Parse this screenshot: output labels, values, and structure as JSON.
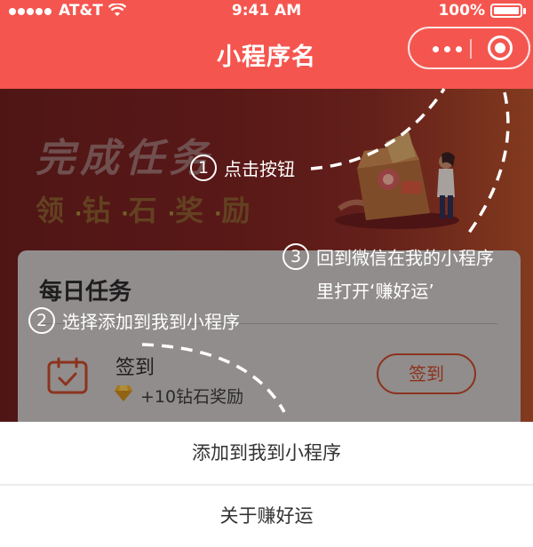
{
  "status_bar": {
    "carrier": "AT&T",
    "time": "9:41 AM",
    "battery": "100%"
  },
  "nav_bar": {
    "title": "小程序名",
    "menu_icon": "more-dots-icon",
    "close_icon": "target-circle-icon"
  },
  "banner": {
    "title": "完成任务",
    "subtitle_chars": [
      "领",
      "钻",
      "石",
      "奖",
      "励"
    ]
  },
  "daily_tasks": {
    "heading": "每日任务",
    "task": {
      "name": "签到",
      "reward": "+10钻石奖励",
      "button": "签到",
      "icon": "calendar-check-icon",
      "reward_icon": "diamond-icon"
    }
  },
  "annotations": [
    {
      "num": "①",
      "text": "点击按钮"
    },
    {
      "num": "②",
      "text": "选择添加到我到小程序"
    },
    {
      "num": "③",
      "line1": "回到微信在我的小程序",
      "line2": "里打开‘赚好运’"
    }
  ],
  "action_sheet": {
    "items": [
      "添加到我到小程序",
      "关于赚好运"
    ]
  },
  "colors": {
    "brand": "#f4564f",
    "accent": "#c2472a",
    "gem": "#e8a626"
  }
}
